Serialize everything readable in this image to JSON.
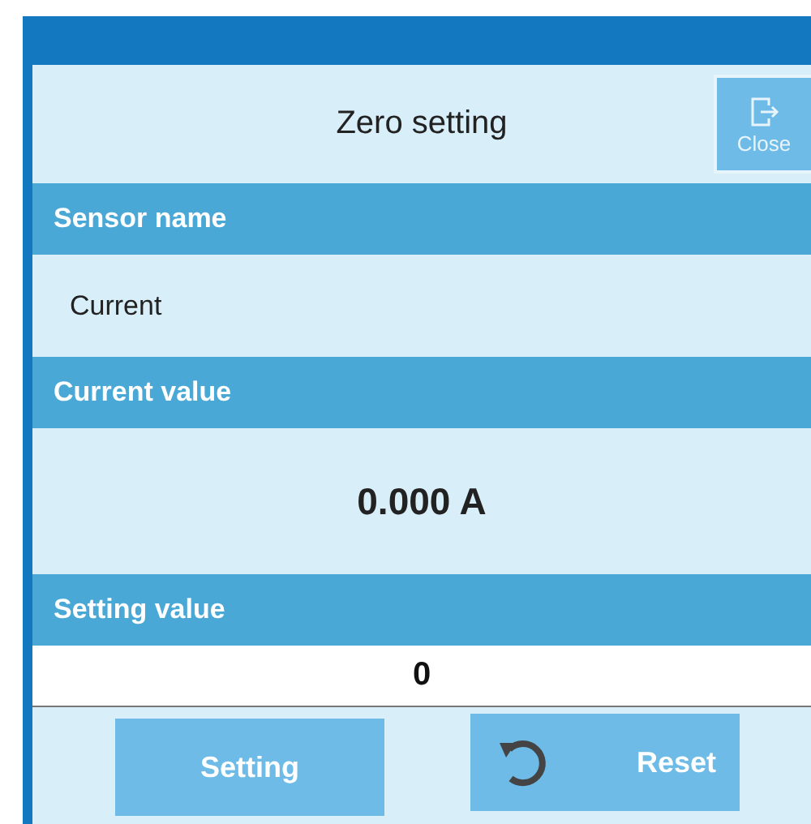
{
  "dialog": {
    "title": "Zero setting",
    "close_button": "Close"
  },
  "sections": [
    {
      "kind": "text",
      "header": "Sensor name",
      "value": "Current"
    },
    {
      "kind": "reading",
      "header": "Current value",
      "value": "0.000 A"
    },
    {
      "kind": "input",
      "header": "Setting value",
      "value": "0"
    }
  ],
  "buttons": [
    {
      "kind": "plain",
      "label": "Setting"
    },
    {
      "kind": "reset",
      "label": "Reset"
    }
  ]
}
